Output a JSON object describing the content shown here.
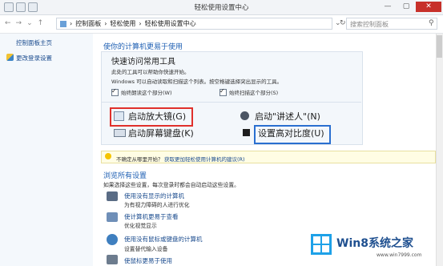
{
  "window": {
    "title": "轻松使用设置中心"
  },
  "breadcrumb": [
    "控制面板",
    "轻松使用",
    "轻松使用设置中心"
  ],
  "search": {
    "placeholder": "搜索控制面板"
  },
  "sidebar": {
    "items": [
      {
        "label": "控制面板主页"
      },
      {
        "label": "更改登录设置"
      }
    ]
  },
  "main": {
    "heading": "使你的计算机更易于使用",
    "quick": {
      "title": "快速访问常用工具",
      "line1": "此处的工具可以帮助你快速开始。",
      "line2": "Windows 可以自动读取和扫描这个列表。按空格键选择突出显示的工具。",
      "checkbox1": "始终朗读这个部分(W)",
      "checkbox2": "始终扫描这个部分(S)",
      "btn_magnifier": "启动放大镜(G)",
      "btn_narrator": "启动\"讲述人\"(N)",
      "btn_osk": "启动屏幕键盘(K)",
      "btn_contrast": "设置高对比度(U)"
    },
    "hint": {
      "prefix": "不确定从哪里开始？",
      "link": "获取更加轻松使用计算机的建议(R)"
    },
    "browse": {
      "title": "浏览所有设置",
      "desc": "如果选择这些设置，每次登录时都会自动启动这些设置。",
      "items": [
        {
          "title": "使用没有显示的计算机",
          "desc": "为有视力障碍的人进行优化"
        },
        {
          "title": "使计算机更易于查看",
          "desc": "优化视觉显示"
        },
        {
          "title": "使用没有鼠标或键盘的计算机",
          "desc": "设置替代输入设备"
        },
        {
          "title": "使鼠标更易于使用"
        }
      ]
    }
  },
  "watermark": {
    "text": "Win8系统之家",
    "url": "www.win7999.com"
  },
  "colors": {
    "link": "#1a4b8e",
    "heading": "#1e5fb3",
    "highlight_red": "#e0302b",
    "highlight_blue": "#2a6fd0"
  }
}
